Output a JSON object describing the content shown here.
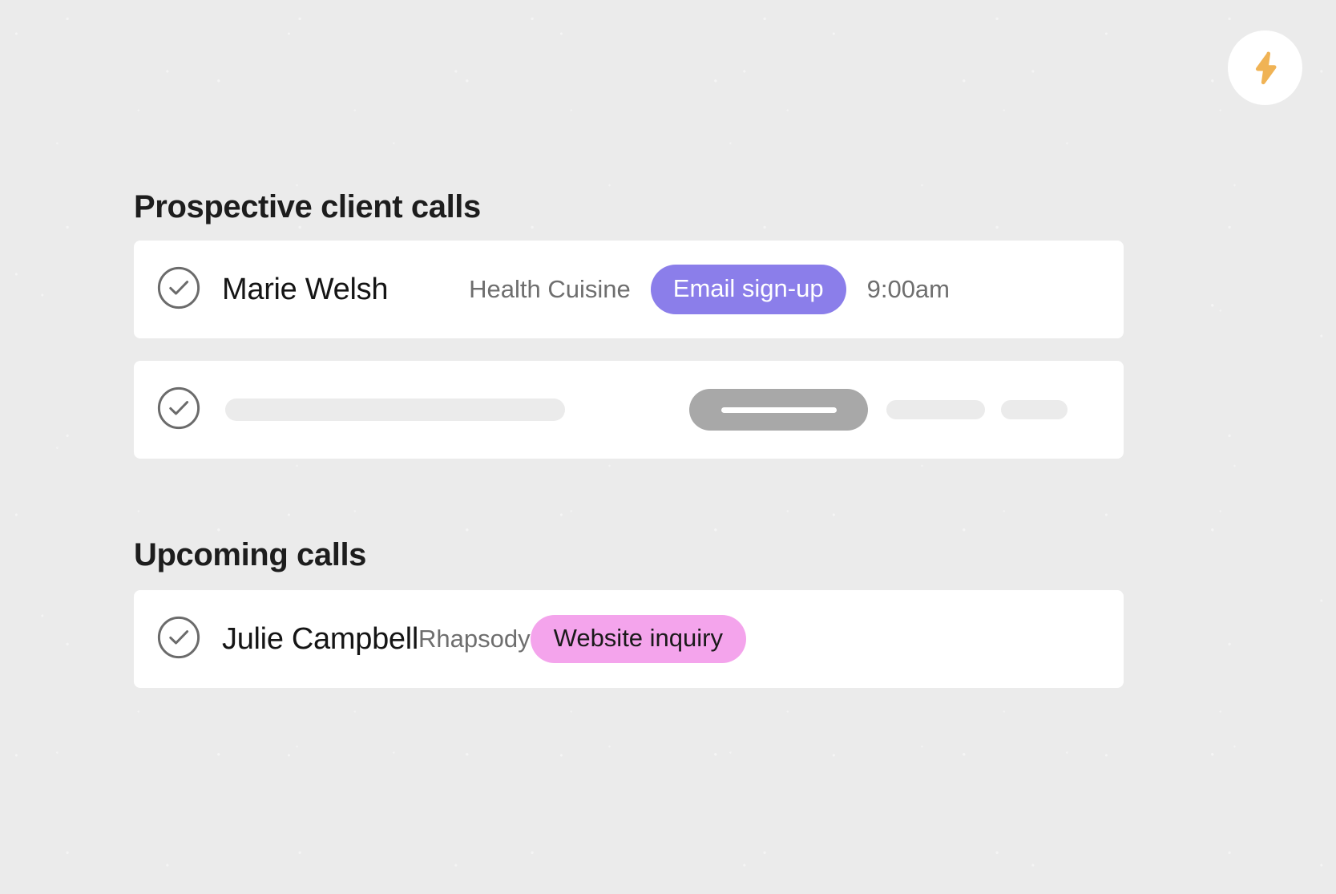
{
  "theme": {
    "background_color": "#ebebeb",
    "card_color": "#ffffff",
    "heading_color": "#1d1d1d",
    "muted_text_color": "#6e6e6e",
    "badge_purple": "#8b7eea",
    "badge_pink": "#f4a4ec",
    "bolt_color": "#f0b355",
    "check_stroke": "#6b6b6b",
    "skeleton_light": "#ebebeb",
    "skeleton_dark": "#a8a8a8"
  },
  "top_bar": {
    "bolt_button": {
      "icon": "lightning-bolt-icon",
      "label": ""
    }
  },
  "sections": [
    {
      "id": "prospective",
      "heading": "Prospective client calls",
      "rows": [
        {
          "type": "call",
          "status_icon": "check-circle-icon",
          "name": "Marie Welsh",
          "company": "Health Cuisine",
          "badge": {
            "label": "Email sign-up",
            "style": "purple"
          },
          "time": "9:00am"
        },
        {
          "type": "skeleton",
          "status_icon": "check-circle-icon"
        }
      ]
    },
    {
      "id": "upcoming",
      "heading": "Upcoming calls",
      "rows": [
        {
          "type": "call",
          "status_icon": "check-circle-icon",
          "name": "Julie Campbell",
          "company": "Rhapsody",
          "badge": {
            "label": "Website inquiry",
            "style": "pink"
          },
          "time": ""
        }
      ]
    }
  ]
}
